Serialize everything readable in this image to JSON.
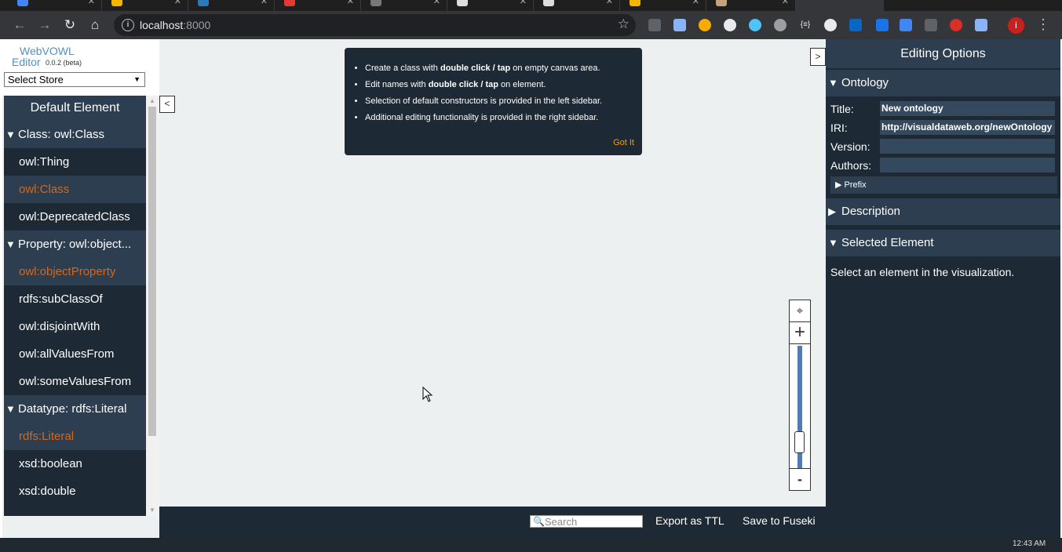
{
  "browser": {
    "url_host": "localhost",
    "url_port": ":8000",
    "profile_initial": "i"
  },
  "logo": {
    "title": "WebVOWL",
    "editor": "Editor",
    "version": "0.0.2 (beta)"
  },
  "store": {
    "selected": "Select Store"
  },
  "left_sidebar": {
    "header": "Default Element",
    "groups": [
      {
        "label": "Class: owl:Class",
        "items": [
          "owl:Thing",
          "owl:Class",
          "owl:DeprecatedClass"
        ]
      },
      {
        "label": "Property: owl:object...",
        "items": [
          "owl:objectProperty",
          "rdfs:subClassOf",
          "owl:disjointWith",
          "owl:allValuesFrom",
          "owl:someValuesFrom"
        ]
      },
      {
        "label": "Datatype: rdfs:Literal",
        "items": [
          "rdfs:Literal",
          "xsd:boolean",
          "xsd:double"
        ]
      }
    ],
    "toggle": "<"
  },
  "help": {
    "items": [
      {
        "pre": "Create a class with ",
        "bold": "double click / tap",
        "post": " on empty canvas area."
      },
      {
        "pre": "Edit names with ",
        "bold": "double click / tap",
        "post": " on element."
      },
      {
        "pre": "Selection of default constructors is provided in the left sidebar.",
        "bold": "",
        "post": ""
      },
      {
        "pre": "Additional editing functionality is provided in the right sidebar.",
        "bold": "",
        "post": ""
      }
    ],
    "got_it": "Got It"
  },
  "zoom": {
    "plus": "+",
    "minus": "-",
    "level": 0.15
  },
  "bottom_bar": {
    "search_placeholder": "Search",
    "export_label": "Export as TTL",
    "save_label": "Save to Fuseki"
  },
  "right_sidebar": {
    "toggle": ">",
    "header": "Editing Options",
    "ontology": {
      "label": "Ontology",
      "fields": [
        {
          "label": "Title:",
          "value": "New ontology"
        },
        {
          "label": "IRI:",
          "value": "http://visualdataweb.org/newOntology"
        },
        {
          "label": "Version:",
          "value": ""
        },
        {
          "label": "Authors:",
          "value": ""
        }
      ],
      "prefix_label": "Prefix"
    },
    "description_label": "Description",
    "selected_label": "Selected Element",
    "selected_hint": "Select an element in the visualization."
  },
  "taskbar": {
    "clock": "12:43 AM"
  },
  "colors": {
    "sidebar_bg": "#1d2935",
    "header_bg": "#2c3e50",
    "accent_selected": "#d2691e",
    "got_it": "#f39c12"
  }
}
